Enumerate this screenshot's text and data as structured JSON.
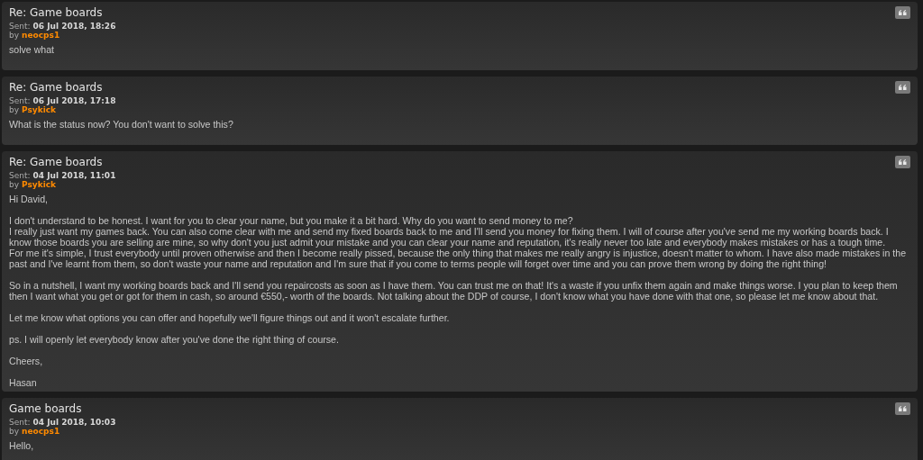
{
  "messages": [
    {
      "title": "Re: Game boards",
      "sent_label": "Sent:",
      "sent": "06 Jul 2018, 18:26",
      "by_label": "by",
      "author": "neocps1",
      "body": [
        [
          "solve what"
        ]
      ]
    },
    {
      "title": "Re: Game boards",
      "sent_label": "Sent:",
      "sent": "06 Jul 2018, 17:18",
      "by_label": "by",
      "author": "Psykick",
      "body": [
        [
          "What is the status now? You don't want to solve this?"
        ]
      ]
    },
    {
      "title": "Re: Game boards",
      "sent_label": "Sent:",
      "sent": "04 Jul 2018, 11:01",
      "by_label": "by",
      "author": "Psykick",
      "body": [
        [
          "Hi David,"
        ],
        [
          "I don't understand to be honest. I want for you to clear your name, but you make it a bit hard. Why do you want to send money to me?",
          "I really just want my games back. You can also come clear with me and send my fixed boards back to me and I'll send you money for fixing them. I will of course after you've send me my working boards back. I know those boards you are selling are mine, so why don't you just admit your mistake and you can clear your name and reputation, it's really never too late and everybody makes mistakes or has a tough time.",
          "For me it's simple, I trust everybody until proven otherwise and then I become really pissed, because the only thing that makes me really angry is injustice, doesn't matter to whom. I have also made mistakes in the past and I've learnt from them, so don't waste your name and reputation and I'm sure that if you come to terms people will forget over time and you can prove them wrong by doing the right thing!"
        ],
        [
          "So in a nutshell, I want my working boards back and I'll send you repaircosts as soon as I have them. You can trust me on that! It's a waste if you unfix them again and make things worse. I you plan to keep them then I want what you get or got for them in cash, so around €550,- worth of the boards. Not talking about the DDP of course, I don't know what you have done with that one, so please let me know about that."
        ],
        [
          "Let me know what options you can offer and hopefully we'll figure things out and it won't escalate further."
        ],
        [
          "ps. I will openly let everybody know after you've done the right thing of course."
        ],
        [
          "Cheers,"
        ],
        [
          "Hasan"
        ]
      ]
    },
    {
      "title": "Game boards",
      "sent_label": "Sent:",
      "sent": "04 Jul 2018, 10:03",
      "by_label": "by",
      "author": "neocps1",
      "body": [
        [
          "Hello,"
        ]
      ]
    }
  ]
}
